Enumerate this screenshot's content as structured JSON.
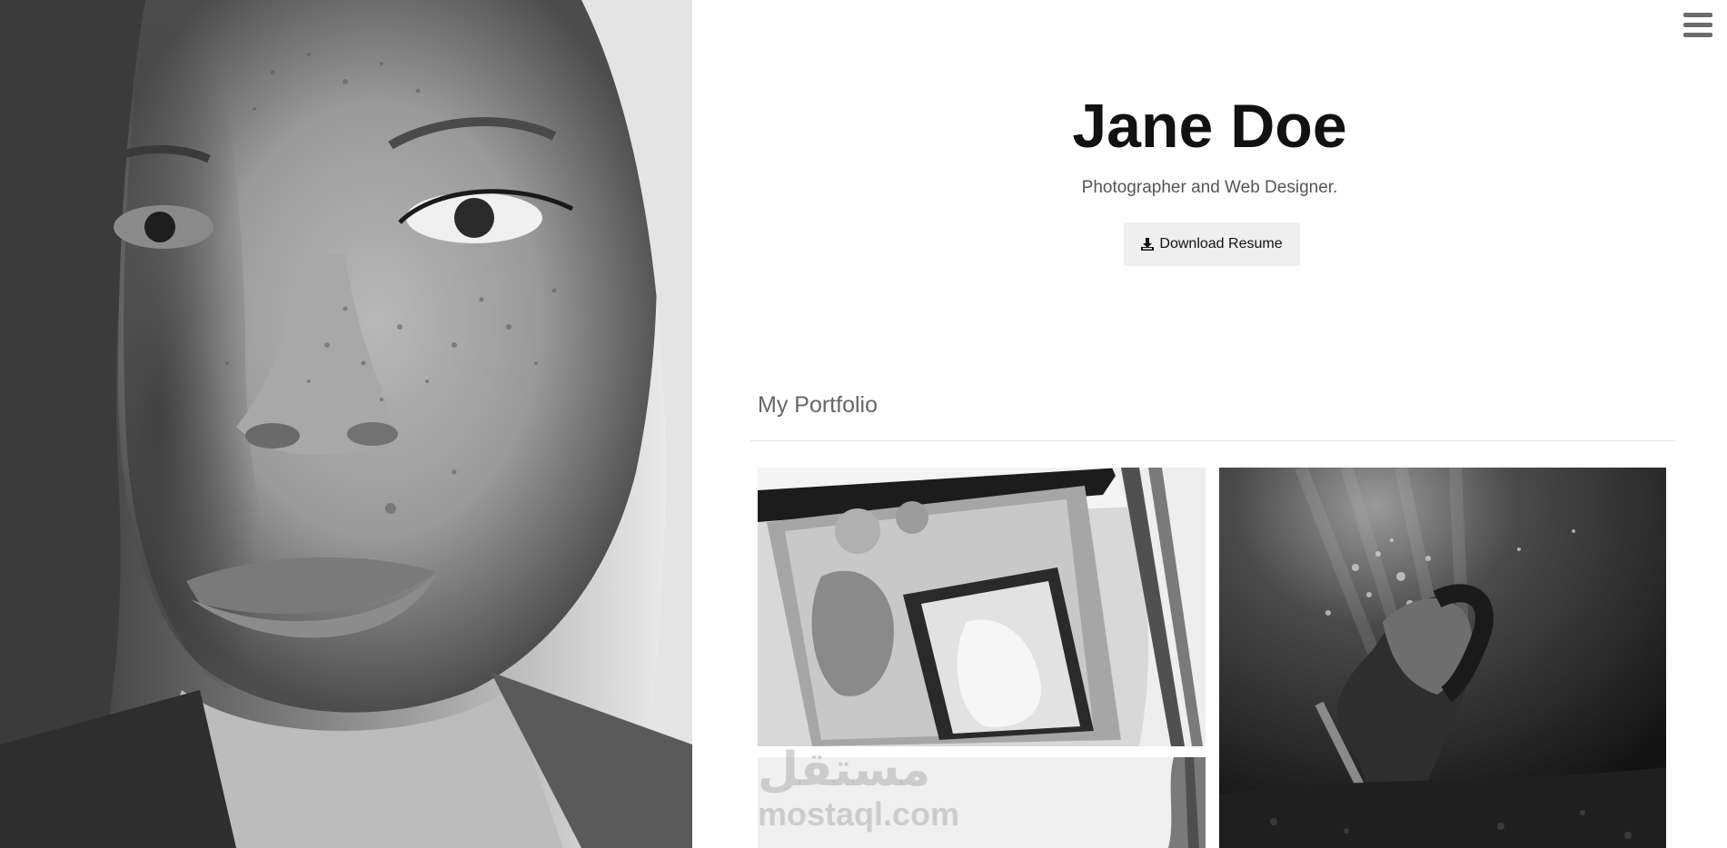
{
  "header": {
    "name": "Jane Doe",
    "tagline": "Photographer and Web Designer.",
    "resume_label": "Download Resume"
  },
  "portfolio": {
    "title": "My Portfolio"
  },
  "watermark": {
    "arabic": "مستقل",
    "latin": "mostaql.com"
  },
  "icons": {
    "menu": "hamburger-menu-icon",
    "download": "download-icon"
  }
}
